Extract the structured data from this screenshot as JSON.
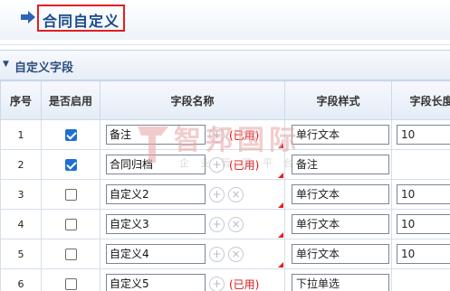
{
  "header": {
    "title": "合同自定义"
  },
  "section": {
    "title": "自定义字段"
  },
  "columns": [
    "序号",
    "是否启用",
    "字段名称",
    "字段样式",
    "字段长度"
  ],
  "rows": [
    {
      "index": "1",
      "enabled": true,
      "name": "备注",
      "used": "(已用)",
      "style": "单行文本",
      "length": "10"
    },
    {
      "index": "2",
      "enabled": true,
      "name": "合同归档",
      "used": "(已用)",
      "style": "备注",
      "length": ""
    },
    {
      "index": "3",
      "enabled": false,
      "name": "自定义2",
      "used": "",
      "style": "单行文本",
      "length": "10"
    },
    {
      "index": "4",
      "enabled": false,
      "name": "自定义3",
      "used": "",
      "style": "单行文本",
      "length": "10"
    },
    {
      "index": "5",
      "enabled": false,
      "name": "自定义4",
      "used": "",
      "style": "单行文本",
      "length": "10"
    },
    {
      "index": "6",
      "enabled": false,
      "name": "自定义5",
      "used": "(已用)",
      "style": "下拉单选",
      "length": ""
    }
  ],
  "icons": {
    "add": "plus-circle-icon",
    "remove": "x-circle-icon",
    "caret": "caret-down-icon",
    "header_arrow": "arrow-right-icon"
  },
  "watermark": {
    "name": "智邦国际",
    "sub": "企业管理平台"
  },
  "colors": {
    "title_border": "#e02020",
    "used_text": "#e01414",
    "checkbox_on": "#1f6fd6",
    "header_text": "#1a4a8a"
  }
}
